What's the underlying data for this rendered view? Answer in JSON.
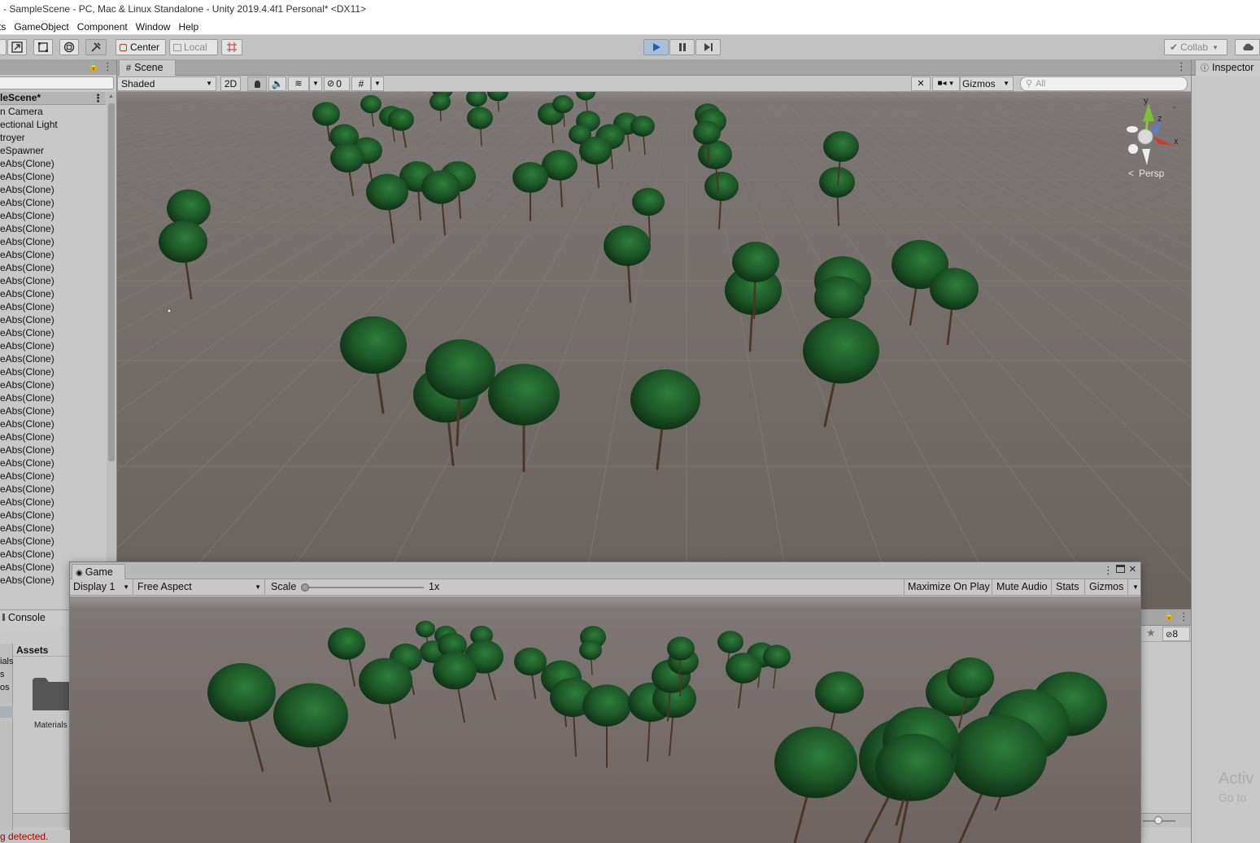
{
  "window": {
    "title": "- SampleScene - PC, Mac & Linux Standalone - Unity 2019.4.4f1 Personal* <DX11>"
  },
  "menu": [
    "ts",
    "GameObject",
    "Component",
    "Window",
    "Help"
  ],
  "toolbar": {
    "pivot_label": "Center",
    "space_label": "Local",
    "collab_label": "Collab"
  },
  "hierarchy": {
    "scene_name": "leScene*",
    "items": [
      "n Camera",
      "ectional Light",
      "troyer",
      "eSpawner",
      "eAbs(Clone)",
      "eAbs(Clone)",
      "eAbs(Clone)",
      "eAbs(Clone)",
      "eAbs(Clone)",
      "eAbs(Clone)",
      "eAbs(Clone)",
      "eAbs(Clone)",
      "eAbs(Clone)",
      "eAbs(Clone)",
      "eAbs(Clone)",
      "eAbs(Clone)",
      "eAbs(Clone)",
      "eAbs(Clone)",
      "eAbs(Clone)",
      "eAbs(Clone)",
      "eAbs(Clone)",
      "eAbs(Clone)",
      "eAbs(Clone)",
      "eAbs(Clone)",
      "eAbs(Clone)",
      "eAbs(Clone)",
      "eAbs(Clone)",
      "eAbs(Clone)",
      "eAbs(Clone)",
      "eAbs(Clone)",
      "eAbs(Clone)",
      "eAbs(Clone)",
      "eAbs(Clone)",
      "eAbs(Clone)",
      "eAbs(Clone)",
      "eAbs(Clone)",
      "eAbs(Clone)"
    ]
  },
  "scene": {
    "tab_label": "Scene",
    "shading_mode": "Shaded",
    "mode_2d": "2D",
    "hidden_count": "0",
    "gizmos_label": "Gizmos",
    "search_placeholder": "All",
    "projection_label": "Persp",
    "axis_y": "y",
    "axis_z": "z",
    "axis_x": "x"
  },
  "inspector": {
    "tab_label": "Inspector"
  },
  "game": {
    "tab_label": "Game",
    "display": "Display 1",
    "aspect": "Free Aspect",
    "scale_label": "Scale",
    "scale_value": "1x",
    "maximize_on_play": "Maximize On Play",
    "mute_audio": "Mute Audio",
    "stats": "Stats",
    "gizmos": "Gizmos"
  },
  "console": {
    "tab_label": "Console"
  },
  "project": {
    "assets_header": "Assets",
    "sidebar_items": [
      "ials",
      "s",
      "os"
    ],
    "folder_name": "Materials",
    "hidden_count": "8"
  },
  "status": {
    "message": "g detected."
  },
  "watermark": {
    "line1": "Activ",
    "line2": "Go to"
  },
  "colors": {
    "play_active": "#a9bfd8",
    "tree_canopy": "#1f5a2a",
    "ground": "#6b635f",
    "error_text": "#b00000"
  }
}
